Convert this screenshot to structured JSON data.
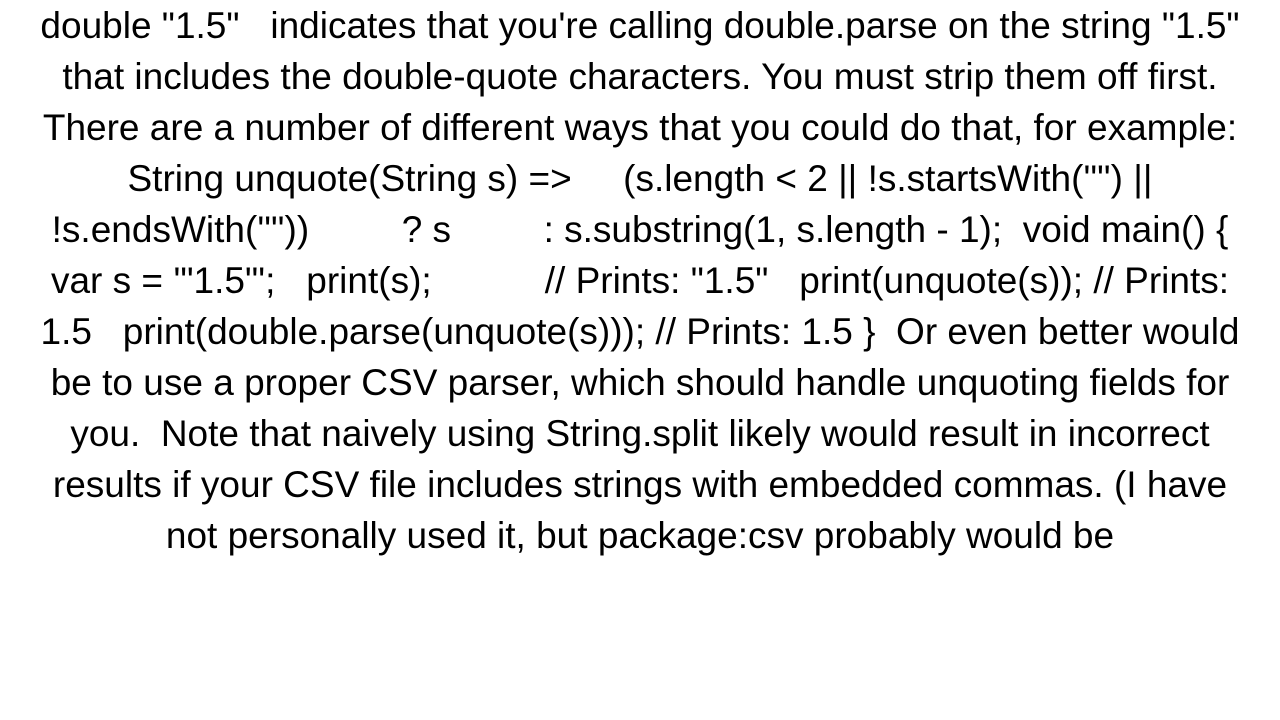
{
  "content": {
    "text": "double \"1.5\"   indicates that you're calling double.parse on the string \"1.5\" that includes the double-quote characters. You must strip them off first.  There are a number of different ways that you could do that, for example: String unquote(String s) =>     (s.length < 2 || !s.startsWith('\"') || !s.endsWith('\"'))         ? s         : s.substring(1, s.length - 1);  void main() {   var s = '\"1.5\"';   print(s);           // Prints: \"1.5\"   print(unquote(s)); // Prints: 1.5   print(double.parse(unquote(s))); // Prints: 1.5 }  Or even better would be to use a proper CSV parser, which should handle unquoting fields for you.  Note that naively using String.split likely would result in incorrect results if your CSV file includes strings with embedded commas. (I have not personally used it, but package:csv probably would be"
  }
}
